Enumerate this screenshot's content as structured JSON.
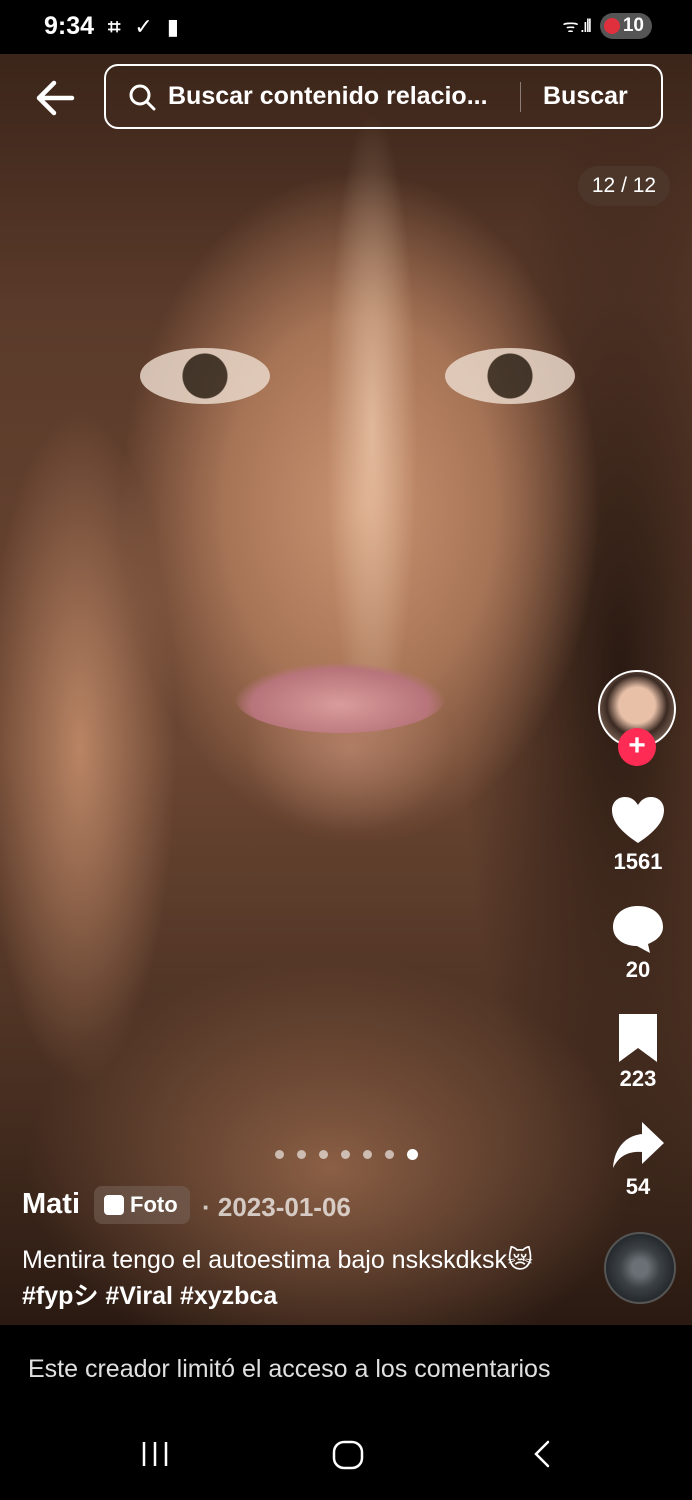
{
  "status_bar": {
    "time": "9:34",
    "battery": "10"
  },
  "header": {
    "search_placeholder": "Buscar contenido relacio...",
    "search_button": "Buscar"
  },
  "photo_counter": "12 / 12",
  "actions": {
    "likes": "1561",
    "comments": "20",
    "saves": "223",
    "shares": "54"
  },
  "carousel": {
    "total": 7,
    "active_index": 6
  },
  "post": {
    "author": "Mati",
    "type_badge": "Foto",
    "date": "· 2023-01-06",
    "caption_text": "Mentira tengo el autoestima bajo nskskdksk😿",
    "hashtags": "#fypシ #Viral #xyzbca"
  },
  "comments_notice": "Este creador limitó el acceso a los comentarios",
  "colors": {
    "accent": "#fe2c55",
    "background": "#000000"
  },
  "icons": [
    "back-arrow-icon",
    "search-icon",
    "heart-icon",
    "comment-icon",
    "bookmark-icon",
    "share-icon",
    "recents-icon",
    "home-icon",
    "back-nav-icon"
  ]
}
